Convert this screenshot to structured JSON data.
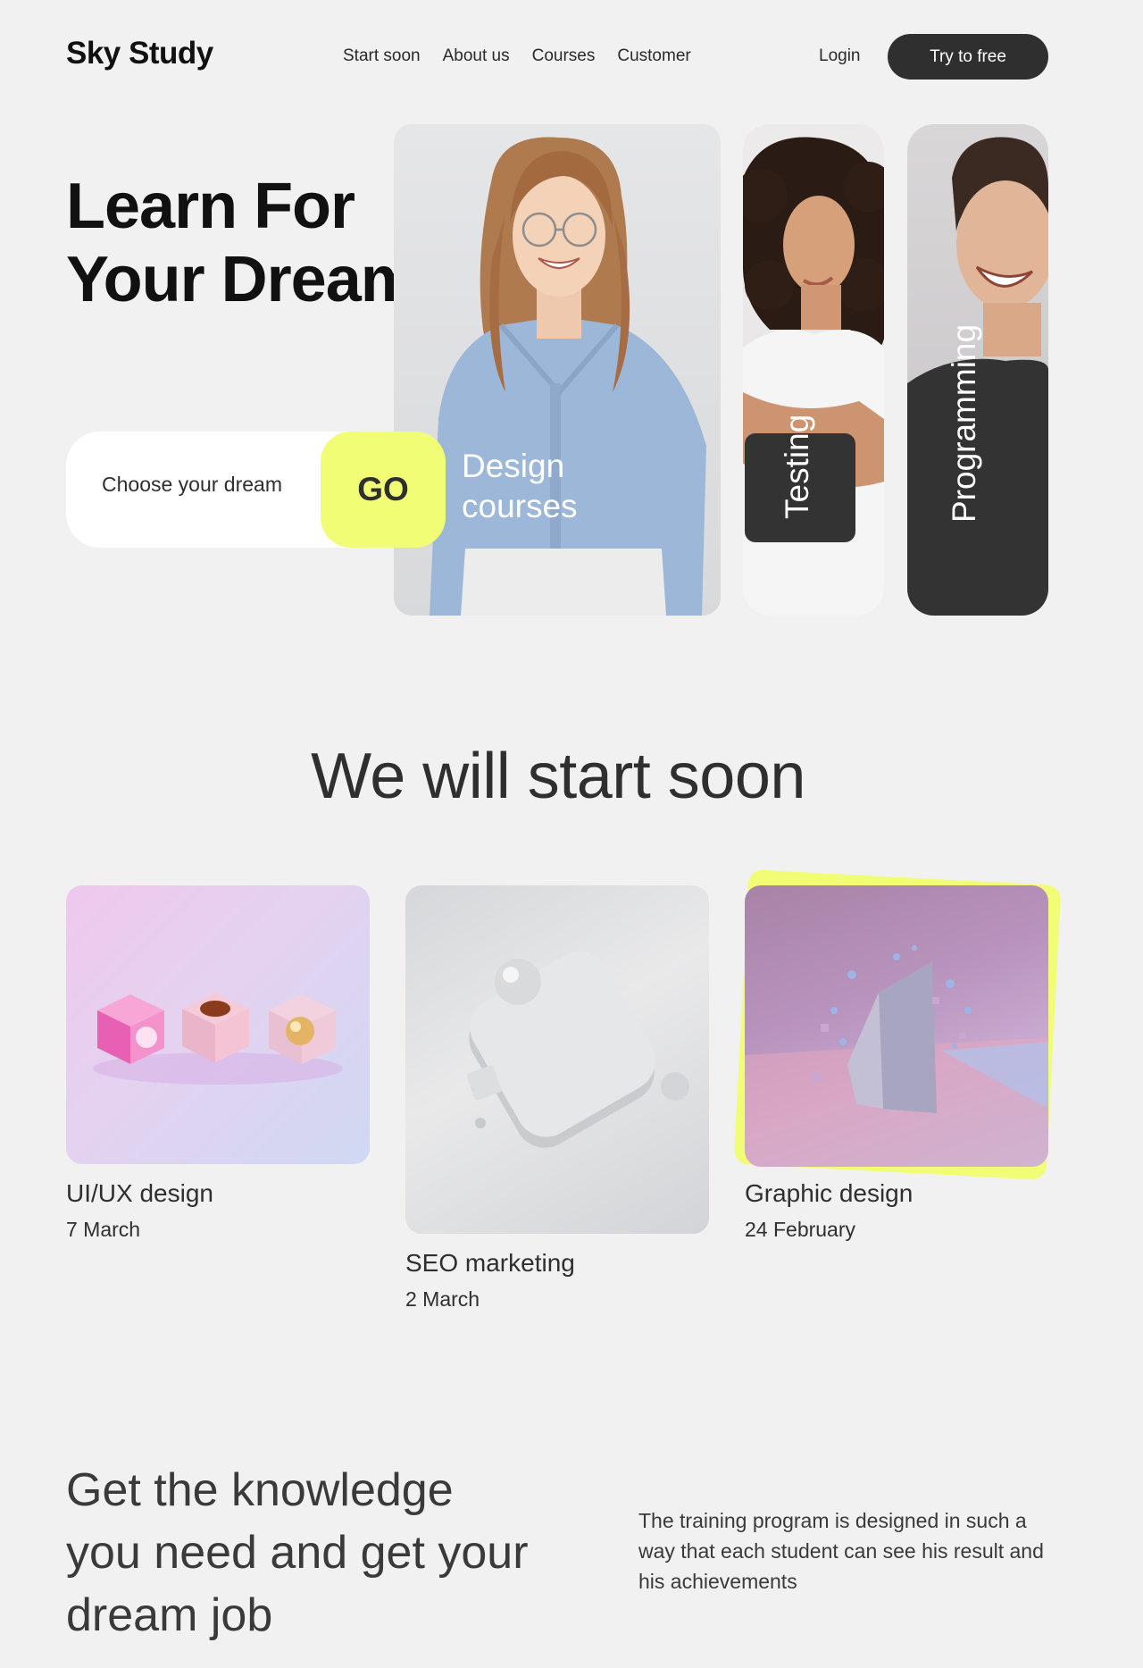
{
  "header": {
    "logo": "Sky Study",
    "nav": [
      "Start soon",
      "About us",
      "Courses",
      "Customer"
    ],
    "login": "Login",
    "try_button": "Try to free"
  },
  "hero": {
    "title_line1": "Learn For",
    "title_line2": "Your Dreams",
    "search_placeholder": "Choose your dream",
    "go_button": "GO",
    "cards": [
      {
        "label_line1": "Design",
        "label_line2": "courses"
      },
      {
        "label": "Testing"
      },
      {
        "label": "Programming"
      }
    ]
  },
  "start_soon": {
    "title": "We will start soon",
    "courses": [
      {
        "name": "UI/UX design",
        "date": "7 March"
      },
      {
        "name": "SEO marketing",
        "date": "2 March"
      },
      {
        "name": "Graphic design",
        "date": "24 February"
      }
    ]
  },
  "knowledge": {
    "title_line1": "Get the knowledge",
    "title_line2": "you need and get your",
    "title_line3": "dream job",
    "description": "The training program is designed in such a way that each student can see his result and his achievements"
  },
  "colors": {
    "accent": "#f1fd74",
    "dark": "#2f2f2f",
    "background": "#f1f1f1"
  }
}
